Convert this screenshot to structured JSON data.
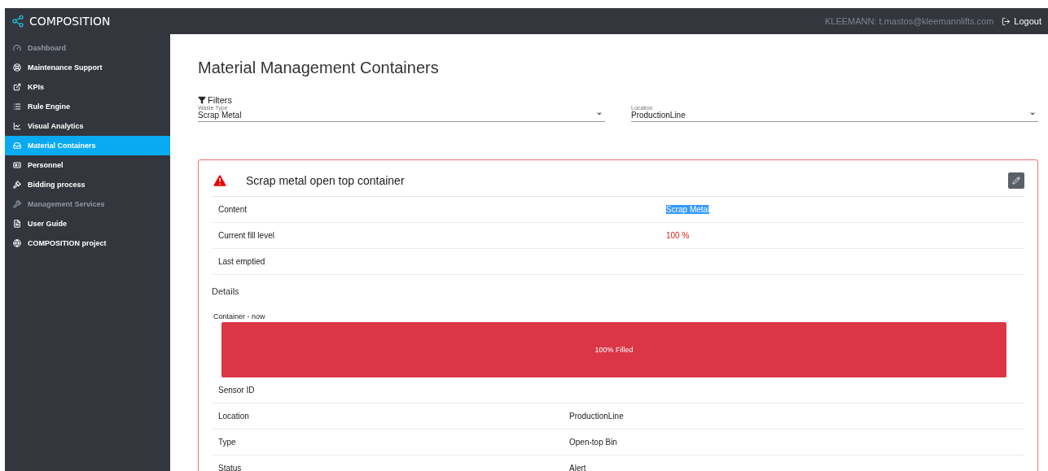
{
  "app": {
    "brand": "COMPOSITION",
    "user": "KLEEMANN: t.mastos@kleemannlifts.com",
    "logout": "Logout"
  },
  "sidebar": {
    "items": [
      {
        "label": "Dashboard",
        "selected": false,
        "disabled": true
      },
      {
        "label": "Maintenance Support",
        "selected": false,
        "disabled": false
      },
      {
        "label": "KPIs",
        "selected": false,
        "disabled": false
      },
      {
        "label": "Rule Engine",
        "selected": false,
        "disabled": false
      },
      {
        "label": "Visual Analytics",
        "selected": false,
        "disabled": false
      },
      {
        "label": "Material Containers",
        "selected": true,
        "disabled": false
      },
      {
        "label": "Personnel",
        "selected": false,
        "disabled": false
      },
      {
        "label": "Bidding process",
        "selected": false,
        "disabled": false
      },
      {
        "label": "Management Services",
        "selected": false,
        "disabled": true
      },
      {
        "label": "User Guide",
        "selected": false,
        "disabled": false
      },
      {
        "label": "COMPOSITION project",
        "selected": false,
        "disabled": false
      }
    ]
  },
  "page": {
    "title": "Material Management Containers",
    "filters": {
      "heading": "Filters",
      "fields": [
        {
          "label": "Waste Type",
          "value": "Scrap Metal"
        },
        {
          "label": "Location",
          "value": "ProductionLine"
        }
      ]
    },
    "container": {
      "title": "Scrap metal open top container",
      "alert": true,
      "summary": [
        {
          "label": "Content",
          "value": "Scrap Metal",
          "kind": "highlighted"
        },
        {
          "label": "Current fill level",
          "value": "100 %",
          "kind": "alert"
        },
        {
          "label": "Last emptied"
        }
      ],
      "details_heading": "Details",
      "gauge": {
        "label": "Container - now",
        "level": 1,
        "text": "100% Filled"
      },
      "details": [
        {
          "label": "Sensor ID"
        },
        {
          "label": "Location",
          "value": "ProductionLine"
        },
        {
          "label": "Type",
          "value": "Open-top Bin"
        },
        {
          "label": "Status",
          "value": "Alert"
        }
      ]
    }
  }
}
